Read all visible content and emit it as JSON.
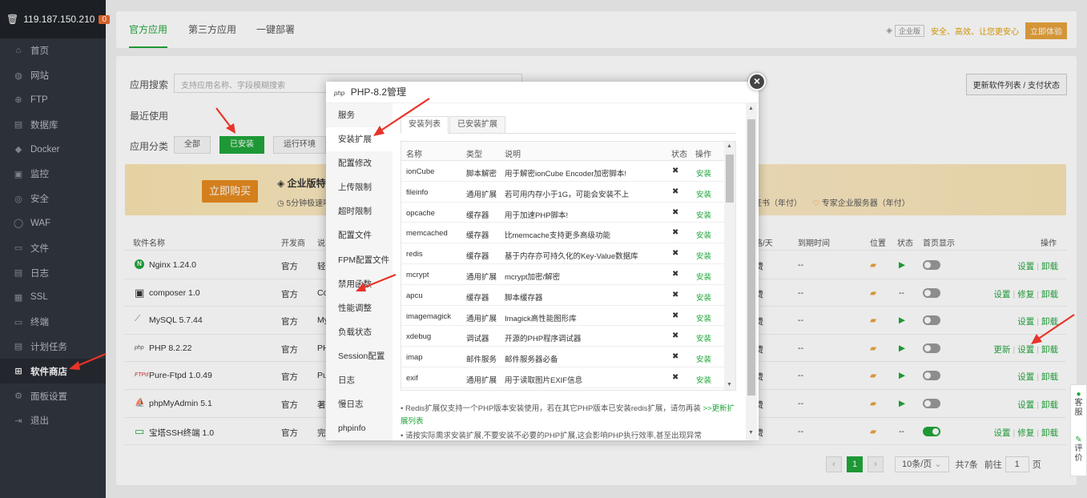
{
  "sidebar": {
    "ip": "119.187.150.210",
    "badge": "0",
    "items": [
      {
        "label": "首页",
        "icon": "home-icon",
        "glyph": "⌂"
      },
      {
        "label": "网站",
        "icon": "globe-icon",
        "glyph": "◍"
      },
      {
        "label": "FTP",
        "icon": "ftp-icon",
        "glyph": "⊕"
      },
      {
        "label": "数据库",
        "icon": "database-icon",
        "glyph": "▤"
      },
      {
        "label": "Docker",
        "icon": "docker-icon",
        "glyph": "◆"
      },
      {
        "label": "监控",
        "icon": "monitor-icon",
        "glyph": "▣"
      },
      {
        "label": "安全",
        "icon": "shield-icon",
        "glyph": "◎"
      },
      {
        "label": "WAF",
        "icon": "waf-icon",
        "glyph": "◯"
      },
      {
        "label": "文件",
        "icon": "folder-icon",
        "glyph": "▭"
      },
      {
        "label": "日志",
        "icon": "log-icon",
        "glyph": "▤"
      },
      {
        "label": "SSL",
        "icon": "ssl-icon",
        "glyph": "▦"
      },
      {
        "label": "终端",
        "icon": "terminal-icon",
        "glyph": "▭"
      },
      {
        "label": "计划任务",
        "icon": "schedule-icon",
        "glyph": "▤"
      },
      {
        "label": "软件商店",
        "icon": "store-icon",
        "glyph": "⊞"
      },
      {
        "label": "面板设置",
        "icon": "settings-icon",
        "glyph": "⚙"
      },
      {
        "label": "退出",
        "icon": "logout-icon",
        "glyph": "⇥"
      }
    ]
  },
  "header": {
    "tabs": [
      "官方应用",
      "第三方应用",
      "一键部署"
    ],
    "enterprise_tag": "企业版",
    "slogan": "安全、高效、让您更安心",
    "try_button": "立即体验"
  },
  "panel": {
    "search_label": "应用搜索",
    "search_placeholder": "支持应用名称、字段模糊搜索",
    "refresh_button": "更新软件列表 / 支付状态",
    "recent_label": "最近使用",
    "category_label": "应用分类",
    "categories": [
      "全部",
      "已安装",
      "运行环境"
    ],
    "banner": {
      "buy_button": "立即购买",
      "title": "企业版特",
      "subtitle": "5分钟极速响",
      "right1": "证书（年付）",
      "right2": "专家企业服务器（年付）"
    },
    "table_headers": {
      "name": "软件名称",
      "developer": "开发商",
      "desc": "说",
      "price": "价格/天",
      "expire": "到期时间",
      "location": "位置",
      "status": "状态",
      "home": "首页显示",
      "ops": "操作"
    },
    "rows": [
      {
        "name": "Nginx 1.24.0",
        "dev": "官方",
        "desc": "轻",
        "price": "免费",
        "expire": "--",
        "ops": [
          "设置",
          "卸载"
        ]
      },
      {
        "name": "composer 1.0",
        "dev": "官方",
        "desc": "Co",
        "price": "免费",
        "expire": "--",
        "ops": [
          "设置",
          "修复",
          "卸载"
        ]
      },
      {
        "name": "MySQL 5.7.44",
        "dev": "官方",
        "desc": "My",
        "price": "免费",
        "expire": "--",
        "ops": [
          "设置",
          "卸载"
        ]
      },
      {
        "name": "PHP 8.2.22",
        "dev": "官方",
        "desc": "PH",
        "price": "免费",
        "expire": "--",
        "ops": [
          "更新",
          "设置",
          "卸载"
        ]
      },
      {
        "name": "Pure-Ftpd 1.0.49",
        "dev": "官方",
        "desc": "Pu",
        "price": "免费",
        "expire": "--",
        "ops": [
          "设置",
          "卸载"
        ]
      },
      {
        "name": "phpMyAdmin 5.1",
        "dev": "官方",
        "desc": "著",
        "price": "免费",
        "expire": "--",
        "ops": [
          "设置",
          "卸载"
        ]
      },
      {
        "name": "宝塔SSH终端 1.0",
        "dev": "官方",
        "desc": "完",
        "price": "免费",
        "expire": "--",
        "ops": [
          "设置",
          "修复",
          "卸载"
        ]
      }
    ],
    "pager": {
      "current": "1",
      "per_page": "10条/页",
      "total": "共7条",
      "goto_label": "前往",
      "goto_value": "1",
      "page_unit": "页"
    }
  },
  "modal": {
    "php_logo": "php",
    "title": "PHP-8.2管理",
    "menu": [
      "服务",
      "安装扩展",
      "配置修改",
      "上传限制",
      "超时限制",
      "配置文件",
      "FPM配置文件",
      "禁用函数",
      "性能调整",
      "负载状态",
      "Session配置",
      "日志",
      "慢日志",
      "phpinfo"
    ],
    "tabs": [
      "安装列表",
      "已安装扩展"
    ],
    "ext_headers": {
      "name": "名称",
      "type": "类型",
      "desc": "说明",
      "status": "状态",
      "op": "操作"
    },
    "extensions": [
      {
        "name": "ionCube",
        "type": "脚本解密",
        "desc": "用于解密ionCube Encoder加密脚本!",
        "op": "安装"
      },
      {
        "name": "fileinfo",
        "type": "通用扩展",
        "desc": "若可用内存小于1G，可能会安装不上",
        "op": "安装"
      },
      {
        "name": "opcache",
        "type": "缓存器",
        "desc": "用于加速PHP脚本!",
        "op": "安装"
      },
      {
        "name": "memcached",
        "type": "缓存器",
        "desc": "比memcache支持更多高级功能",
        "op": "安装"
      },
      {
        "name": "redis",
        "type": "缓存器",
        "desc": "基于内存亦可持久化的Key-Value数据库",
        "op": "安装"
      },
      {
        "name": "mcrypt",
        "type": "通用扩展",
        "desc": "mcrypt加密/解密",
        "op": "安装"
      },
      {
        "name": "apcu",
        "type": "缓存器",
        "desc": "脚本缓存器",
        "op": "安装"
      },
      {
        "name": "imagemagick",
        "type": "通用扩展",
        "desc": "Imagick高性能图形库",
        "op": "安装"
      },
      {
        "name": "xdebug",
        "type": "调试器",
        "desc": "开源的PHP程序调试器",
        "op": "安装"
      },
      {
        "name": "imap",
        "type": "邮件服务",
        "desc": "邮件服务器必备",
        "op": "安装"
      },
      {
        "name": "exif",
        "type": "通用扩展",
        "desc": "用于读取图片EXIF信息",
        "op": "安装"
      }
    ],
    "status_mark": "✖",
    "note1": "Redis扩展仅支持一个PHP版本安装使用，若在其它PHP版本已安装redis扩展，请勿再装",
    "note1_link": ">>更新扩展列表",
    "note2": "请按实际需求安装扩展,不要安装不必要的PHP扩展,这会影响PHP执行效率,甚至出现异常"
  },
  "float_panel": {
    "service": "客服",
    "review": "评价"
  },
  "colors": {
    "accent": "#20a53a",
    "sidebar": "#30353d",
    "arrow": "#e8332a",
    "orange": "#e58a1f"
  }
}
